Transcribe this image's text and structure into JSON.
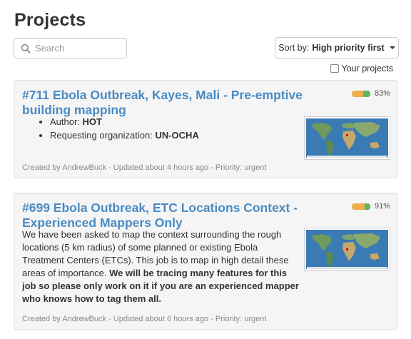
{
  "page": {
    "title": "Projects"
  },
  "search": {
    "placeholder": "Search"
  },
  "sort": {
    "prefix": "Sort by:",
    "value": "High priority first"
  },
  "filter": {
    "your_projects_label": "Your projects",
    "checked": false
  },
  "colors": {
    "link": "#4a8bc4",
    "progress_mapped": "#f0ad4e",
    "progress_validated": "#5cb85c",
    "aoi_marker": "#e00000"
  },
  "projects": [
    {
      "title": "#711 Ebola Outbreak, Kayes, Mali - Pre-emptive building mapping",
      "progress_label": "83%",
      "progress_fraction": 0.83,
      "details": [
        {
          "label": "Author:",
          "value": "HOT"
        },
        {
          "label": "Requesting organization:",
          "value": "UN-OCHA"
        }
      ],
      "meta": "Created by AndrewBuck - Updated about 4 hours ago - Priority: urgent"
    },
    {
      "title": "#699 Ebola Outbreak, ETC Locations Context - Experienced Mappers Only",
      "progress_label": "91%",
      "progress_fraction": 0.91,
      "description": "We have been asked to map the context surrounding the rough locations (5 km radius) of some planned or existing Ebola Treatment Centers (ETCs). This job is to map in high detail these areas of importance.",
      "description_bold": "We will be tracing many features for this job so please only work on it if you are an experienced mapper who knows how to tag them all.",
      "meta": "Created by AndrewBuck - Updated about 6 hours ago - Priority: urgent"
    }
  ]
}
